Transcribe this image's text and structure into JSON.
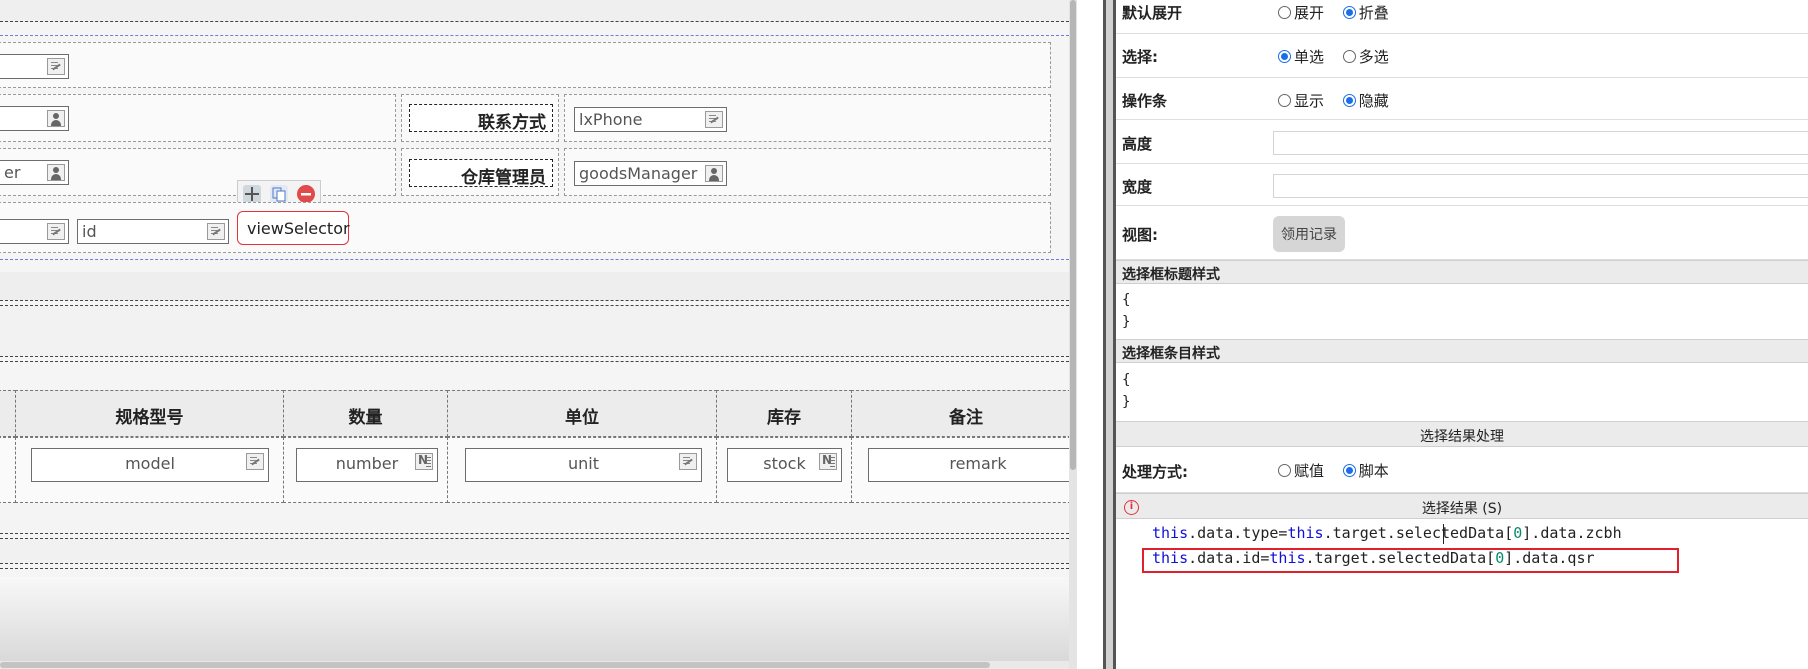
{
  "form_fields": {
    "row2_right_label": "联系方式",
    "row2_right_input": "lxPhone",
    "row3_left_input": "er",
    "row3_right_label": "仓库管理员",
    "row3_right_input": "goodsManager",
    "row4_input": "id",
    "view_selector": "viewSelector"
  },
  "table": {
    "columns": [
      "规格型号",
      "数量",
      "单位",
      "库存",
      "备注"
    ],
    "inputs": [
      "model",
      "number",
      "unit",
      "stock",
      "remark"
    ]
  },
  "panel": {
    "default_expand": {
      "label": "默认展开",
      "options": [
        "展开",
        "折叠"
      ],
      "selected": "折叠"
    },
    "select": {
      "label": "选择:",
      "options": [
        "单选",
        "多选"
      ],
      "selected": "单选"
    },
    "action_bar": {
      "label": "操作条",
      "options": [
        "显示",
        "隐藏"
      ],
      "selected": "隐藏"
    },
    "height": {
      "label": "高度",
      "value": ""
    },
    "width": {
      "label": "宽度",
      "value": ""
    },
    "view": {
      "label": "视图:",
      "button": "领用记录"
    },
    "title_style": {
      "label": "选择框标题样式",
      "open": "{",
      "close": "}"
    },
    "item_style": {
      "label": "选择框条目样式",
      "open": "{",
      "close": "}"
    },
    "result_processing": "选择结果处理",
    "process_mode": {
      "label": "处理方式:",
      "options": [
        "赋值",
        "脚本"
      ],
      "selected": "脚本"
    },
    "result_section": "选择结果 (S)",
    "error_icon": "i",
    "code": {
      "line1": {
        "kw1": "this",
        "a": ".data.type=",
        "kw2": "this",
        "b": ".target.selectedData[",
        "n": "0",
        "c": "].data.zcbh"
      },
      "line2": {
        "kw1": "this",
        "a": ".data.id=",
        "kw2": "this",
        "b": ".target.selectedData[",
        "n": "0",
        "c": "].data.qsr"
      }
    }
  },
  "colors": {
    "accent_blue": "#1a6ee6",
    "highlight_red": "#e0202a",
    "keyword_blue": "#1010d8",
    "number_green": "#0a8a6a"
  },
  "icons": [
    "pencil-icon",
    "person-icon",
    "numbers-icon",
    "move-icon",
    "copy-icon",
    "delete-icon",
    "error-icon"
  ]
}
